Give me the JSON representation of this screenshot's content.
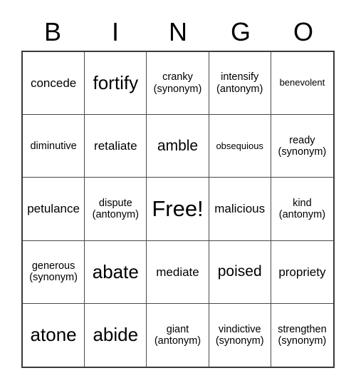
{
  "header": {
    "letters": [
      "B",
      "I",
      "N",
      "G",
      "O"
    ]
  },
  "card": {
    "free_space_label": "Free!",
    "rows": [
      [
        {
          "text": "concede",
          "size": "m"
        },
        {
          "text": "fortify",
          "size": "xl"
        },
        {
          "text": "cranky\n(synonym)",
          "size": "s"
        },
        {
          "text": "intensify\n(antonym)",
          "size": "s"
        },
        {
          "text": "benevolent",
          "size": "xs"
        }
      ],
      [
        {
          "text": "diminutive",
          "size": "s"
        },
        {
          "text": "retaliate",
          "size": "m"
        },
        {
          "text": "amble",
          "size": "l"
        },
        {
          "text": "obsequious",
          "size": "xs"
        },
        {
          "text": "ready\n(synonym)",
          "size": "s"
        }
      ],
      [
        {
          "text": "petulance",
          "size": "m"
        },
        {
          "text": "dispute\n(antonym)",
          "size": "s"
        },
        {
          "text": "Free!",
          "size": "xxl"
        },
        {
          "text": "malicious",
          "size": "m"
        },
        {
          "text": "kind\n(antonym)",
          "size": "s"
        }
      ],
      [
        {
          "text": "generous\n(synonym)",
          "size": "s"
        },
        {
          "text": "abate",
          "size": "xl"
        },
        {
          "text": "mediate",
          "size": "m"
        },
        {
          "text": "poised",
          "size": "l"
        },
        {
          "text": "propriety",
          "size": "m"
        }
      ],
      [
        {
          "text": "atone",
          "size": "xl"
        },
        {
          "text": "abide",
          "size": "xl"
        },
        {
          "text": "giant\n(antonym)",
          "size": "s"
        },
        {
          "text": "vindictive\n(synonym)",
          "size": "s"
        },
        {
          "text": "strengthen\n(synonym)",
          "size": "s"
        }
      ]
    ]
  },
  "colors": {
    "background": "#ffffff",
    "text": "#000000",
    "outer_border": "#3a3a3a",
    "inner_border": "#4a4a4a"
  }
}
